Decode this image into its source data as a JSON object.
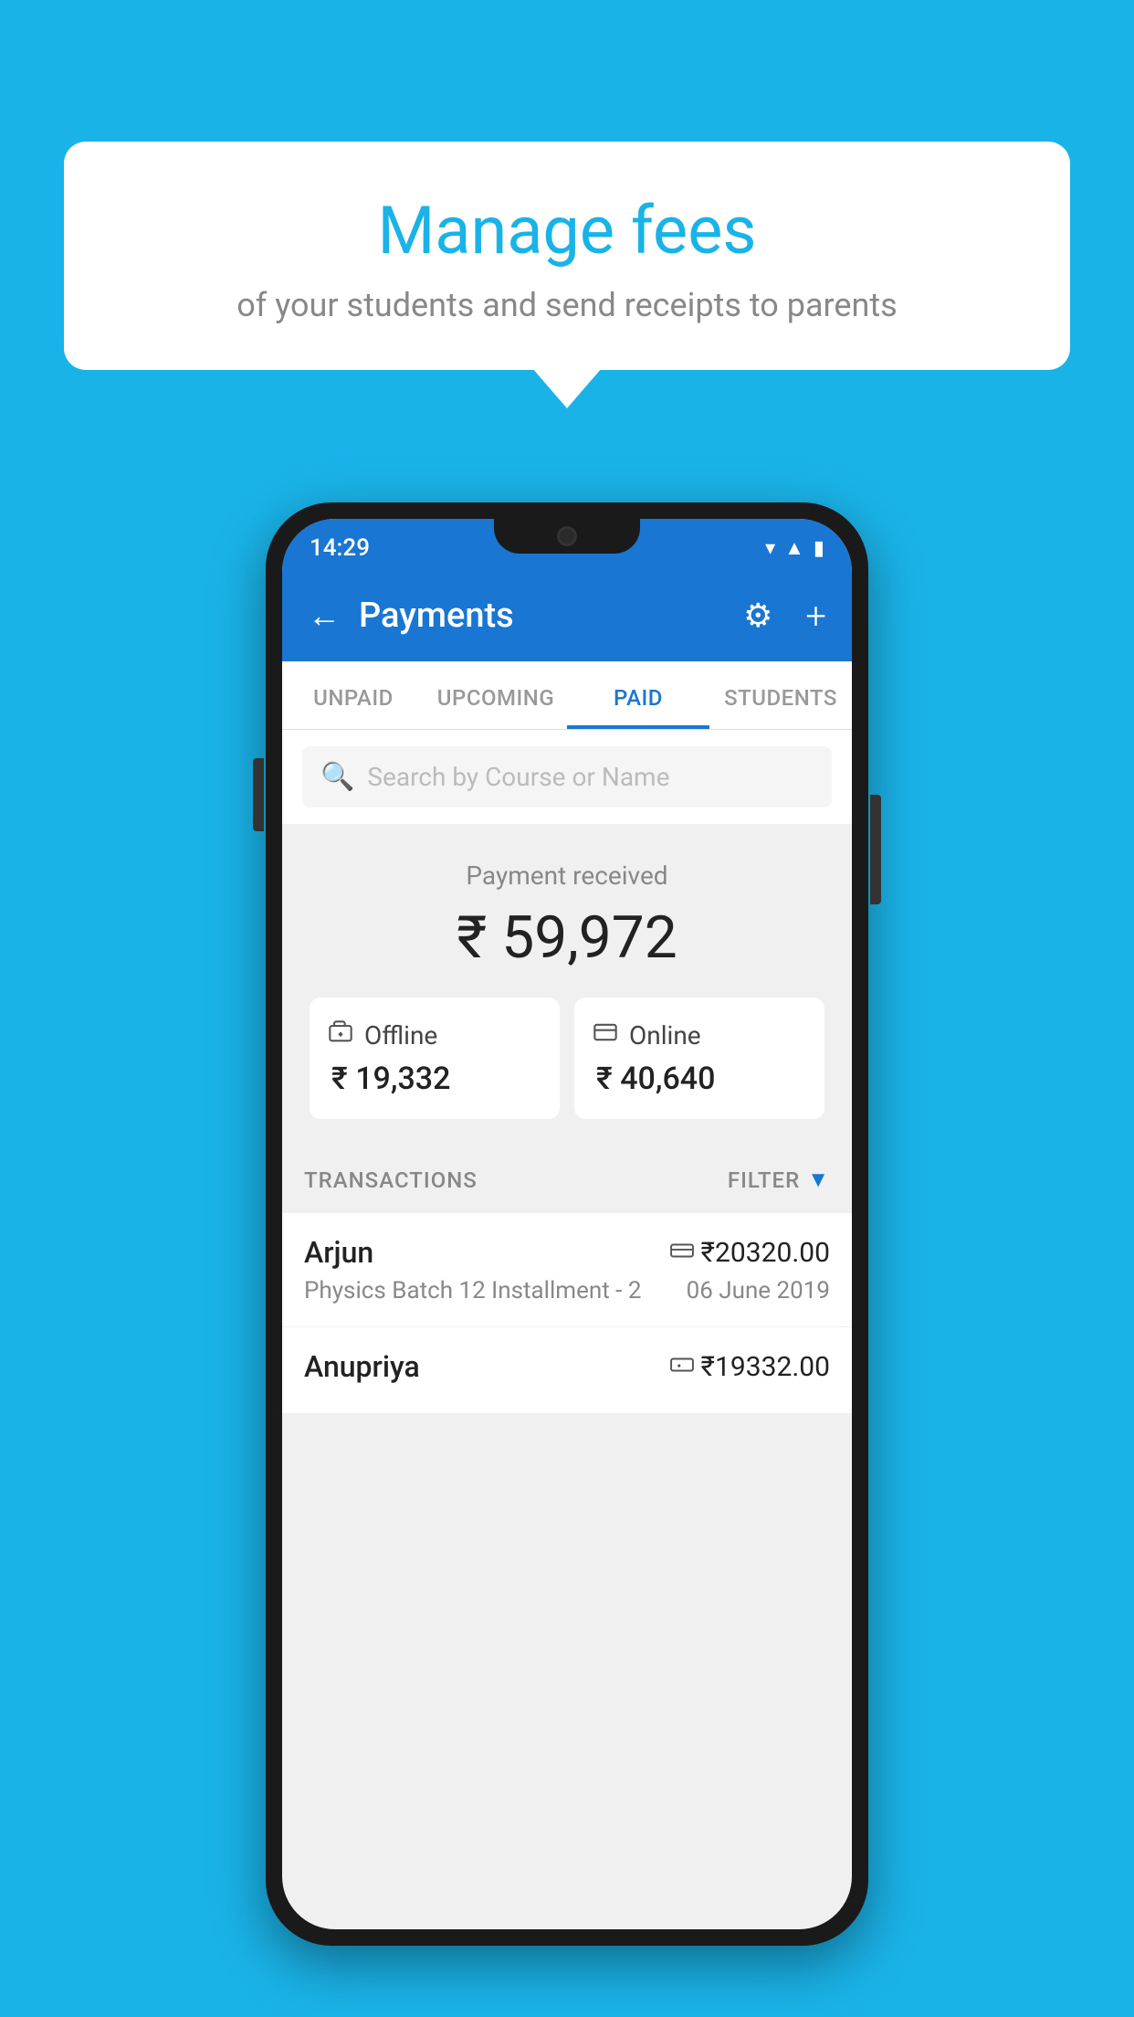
{
  "background_color": "#1ab3e8",
  "speech_bubble": {
    "title": "Manage fees",
    "subtitle": "of your students and send receipts to parents"
  },
  "status_bar": {
    "time": "14:29",
    "icons": [
      "wifi",
      "signal",
      "battery"
    ]
  },
  "app_bar": {
    "title": "Payments",
    "back_label": "←",
    "gear_label": "⚙",
    "plus_label": "+"
  },
  "tabs": [
    {
      "label": "UNPAID",
      "active": false
    },
    {
      "label": "UPCOMING",
      "active": false
    },
    {
      "label": "PAID",
      "active": true
    },
    {
      "label": "STUDENTS",
      "active": false
    }
  ],
  "search": {
    "placeholder": "Search by Course or Name"
  },
  "payment_summary": {
    "label": "Payment received",
    "total_amount": "₹ 59,972",
    "offline": {
      "icon": "💳",
      "label": "Offline",
      "amount": "₹ 19,332"
    },
    "online": {
      "icon": "💳",
      "label": "Online",
      "amount": "₹ 40,640"
    }
  },
  "transactions": {
    "label": "TRANSACTIONS",
    "filter_label": "FILTER",
    "items": [
      {
        "name": "Arjun",
        "amount": "₹20320.00",
        "course": "Physics Batch 12 Installment - 2",
        "date": "06 June 2019",
        "payment_type": "online"
      },
      {
        "name": "Anupriya",
        "amount": "₹19332.00",
        "course": "",
        "date": "",
        "payment_type": "offline"
      }
    ]
  }
}
